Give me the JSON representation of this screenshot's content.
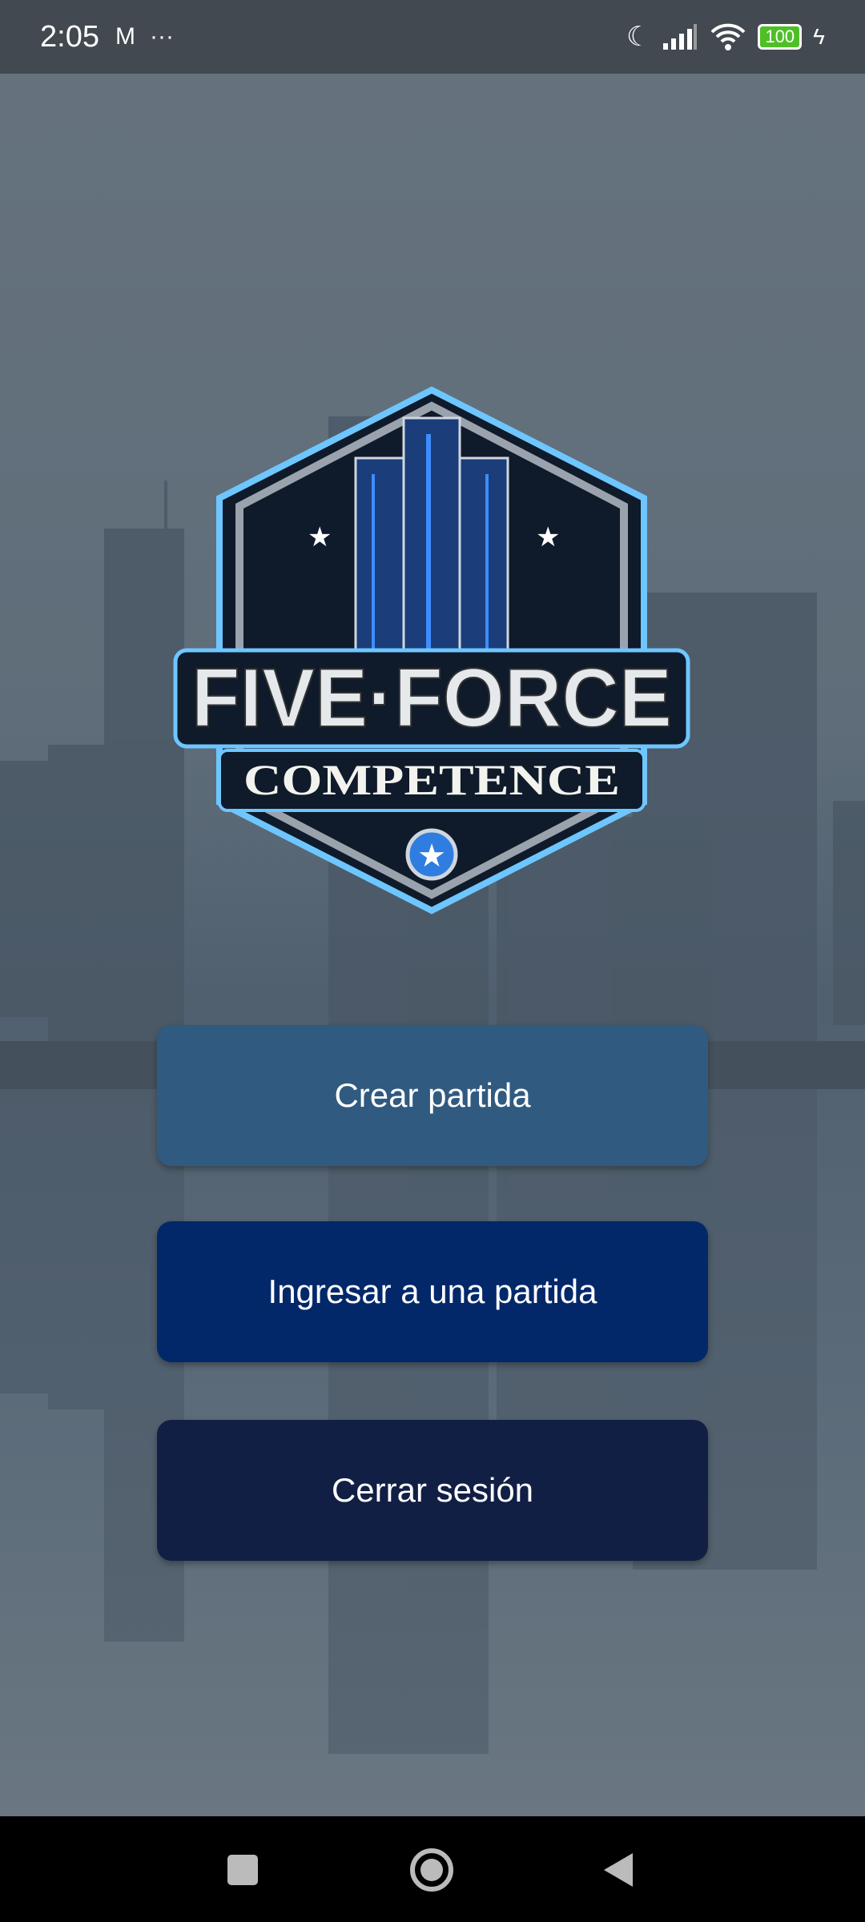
{
  "status_bar": {
    "time": "2:05",
    "battery": "100",
    "icons": [
      "gmail-icon",
      "more-dots-icon",
      "moon-icon",
      "signal-icon",
      "wifi-icon",
      "battery-icon",
      "charging-icon"
    ]
  },
  "logo": {
    "line1": "FIVE·FORCE",
    "line2": "COMPETENCE"
  },
  "buttons": {
    "create": {
      "label": "Crear partida",
      "color": "#315a80"
    },
    "join": {
      "label": "Ingresar a una partida",
      "color": "#03286a"
    },
    "logout": {
      "label": "Cerrar sesión",
      "color": "#121f45"
    }
  },
  "nav": {
    "icons": [
      "recents-square-icon",
      "home-circle-icon",
      "back-triangle-icon"
    ]
  }
}
